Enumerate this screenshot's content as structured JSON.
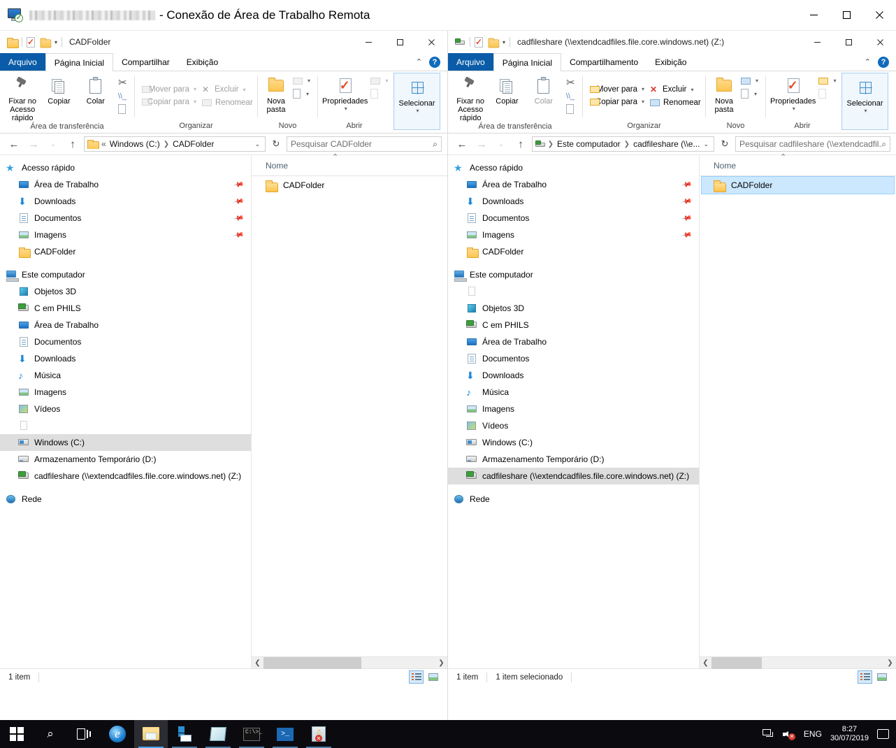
{
  "rdp": {
    "title_suffix": "- Conexão de Área de Trabalho Remota",
    "host_name_redacted": "",
    "controls": {
      "minimize": "—",
      "maximize": "☐",
      "close": "✕"
    }
  },
  "colors": {
    "accent": "#0a5ca8",
    "selection_fill": "#cce8ff",
    "selection_border": "#99d1ff",
    "tree_selection": "#dedede",
    "taskbar": "#0b0b0f"
  },
  "left_window": {
    "qat": {
      "folder_icon": "folder-icon",
      "properties_icon": "properties-icon",
      "new_folder_icon": "new-folder-icon",
      "customize_caret": "▾"
    },
    "title": "CADFolder",
    "controls": {
      "minimize": "—",
      "maximize": "☐",
      "close": "✕"
    },
    "tabs": [
      {
        "label": "Arquivo",
        "type": "file"
      },
      {
        "label": "Página Inicial",
        "type": "active"
      },
      {
        "label": "Compartilhar",
        "type": "normal"
      },
      {
        "label": "Exibição",
        "type": "normal"
      }
    ],
    "ribbon_collapse": "⌃",
    "help_label": "?",
    "ribbon": {
      "clipboard": {
        "group_label": "Área de transferência",
        "pin": "Fixar no\nAcesso rápido",
        "pin_line1": "Fixar no",
        "pin_line2": "Acesso rápido",
        "copy": "Copiar",
        "paste": "Colar",
        "cut_icon": "scissors-icon",
        "copy_path_icon": "copy-path-icon",
        "paste_shortcut_icon": "paste-shortcut-icon"
      },
      "organize": {
        "group_label": "Organizar",
        "move_to": "Mover para",
        "copy_to": "Copiar para",
        "delete": "Excluir",
        "rename": "Renomear"
      },
      "new": {
        "group_label": "Novo",
        "new_folder_line1": "Nova",
        "new_folder_line2": "pasta",
        "new_item_icon": "new-item-icon",
        "easy_access_icon": "easy-access-icon"
      },
      "open": {
        "group_label": "Abrir",
        "properties": "Propriedades",
        "open_icon": "open-icon",
        "edit_icon": "edit-icon",
        "history_icon": "history-icon"
      },
      "select": {
        "group_label": "",
        "select": "Selecionar"
      }
    },
    "nav": {
      "back": "←",
      "forward": "→",
      "recent": "⌄",
      "up": "↑",
      "breadcrumb_prefix": "«",
      "breadcrumb": [
        "Windows (C:)",
        "CADFolder"
      ],
      "breadcrumb_icon": "folder-icon",
      "dropdown": "⌄",
      "refresh": "↻",
      "search_placeholder": "Pesquisar CADFolder"
    },
    "tree": [
      {
        "label": "Acesso rápido",
        "icon": "star-icon",
        "indent": 0,
        "pinned": false
      },
      {
        "label": "Área de Trabalho",
        "icon": "desktop-icon",
        "indent": 1,
        "pinned": true
      },
      {
        "label": "Downloads",
        "icon": "download-icon",
        "indent": 1,
        "pinned": true
      },
      {
        "label": "Documentos",
        "icon": "documents-icon",
        "indent": 1,
        "pinned": true
      },
      {
        "label": "Imagens",
        "icon": "pictures-icon",
        "indent": 1,
        "pinned": true
      },
      {
        "label": "CADFolder",
        "icon": "folder-icon",
        "indent": 1,
        "pinned": false
      },
      {
        "label": "",
        "icon": "spacer",
        "indent": 0,
        "spacer": true
      },
      {
        "label": "Este computador",
        "icon": "this-pc-icon",
        "indent": 0,
        "pinned": false
      },
      {
        "label": "Objetos 3D",
        "icon": "objects3d-icon",
        "indent": 1,
        "pinned": false
      },
      {
        "label": "C em PHILS",
        "icon": "network-drive-icon",
        "indent": 1,
        "pinned": false
      },
      {
        "label": "Área de Trabalho",
        "icon": "desktop-icon",
        "indent": 1,
        "pinned": false
      },
      {
        "label": "Documentos",
        "icon": "documents-icon",
        "indent": 1,
        "pinned": false
      },
      {
        "label": "Downloads",
        "icon": "download-icon",
        "indent": 1,
        "pinned": false
      },
      {
        "label": "Música",
        "icon": "music-icon",
        "indent": 1,
        "pinned": false
      },
      {
        "label": "Imagens",
        "icon": "pictures-icon",
        "indent": 1,
        "pinned": false
      },
      {
        "label": "Vídeos",
        "icon": "videos-icon",
        "indent": 1,
        "pinned": false
      },
      {
        "label": "",
        "icon": "blank-icon",
        "indent": 1,
        "pinned": false
      },
      {
        "label": "Windows (C:)",
        "icon": "windows-drive-icon",
        "indent": 1,
        "selected": true
      },
      {
        "label": "Armazenamento Temporário (D:)",
        "icon": "hdd-icon",
        "indent": 1,
        "pinned": false
      },
      {
        "label": "cadfileshare (\\\\extendcadfiles.file.core.windows.net) (Z:)",
        "icon": "network-drive-icon",
        "indent": 1,
        "pinned": false
      },
      {
        "label": "",
        "icon": "spacer",
        "indent": 0,
        "spacer": true
      },
      {
        "label": "Rede",
        "icon": "network-icon",
        "indent": 0,
        "pinned": false
      }
    ],
    "list": {
      "column_header": "Nome",
      "sort_arrow": "⌃",
      "items": [
        {
          "label": "CADFolder",
          "icon": "folder-icon",
          "selected": false
        }
      ]
    },
    "status": {
      "count": "1 item",
      "selected": ""
    },
    "view_buttons": {
      "details": "details-view-icon",
      "large": "large-icons-view-icon"
    }
  },
  "right_window": {
    "qat": {
      "drive_icon": "network-drive-icon",
      "properties_icon": "properties-icon",
      "new_folder_icon": "new-folder-icon",
      "customize_caret": "▾"
    },
    "title": "cadfileshare (\\\\extendcadfiles.file.core.windows.net) (Z:)",
    "controls": {
      "minimize": "—",
      "maximize": "☐",
      "close": "✕"
    },
    "tabs": [
      {
        "label": "Arquivo",
        "type": "file"
      },
      {
        "label": "Página Inicial",
        "type": "active"
      },
      {
        "label": "Compartilhamento",
        "type": "normal"
      },
      {
        "label": "Exibição",
        "type": "normal"
      }
    ],
    "ribbon_collapse": "⌃",
    "help_label": "?",
    "nav": {
      "back": "←",
      "forward": "→",
      "recent": "⌄",
      "up": "↑",
      "breadcrumb": [
        "Este computador",
        "cadfileshare (\\\\e..."
      ],
      "breadcrumb_icon": "network-drive-icon",
      "dropdown": "⌄",
      "refresh": "↻",
      "search_placeholder": "Pesquisar cadfileshare (\\\\extendcadfil..."
    },
    "tree": [
      {
        "label": "Acesso rápido",
        "icon": "star-icon",
        "indent": 0,
        "pinned": false
      },
      {
        "label": "Área de Trabalho",
        "icon": "desktop-icon",
        "indent": 1,
        "pinned": true
      },
      {
        "label": "Downloads",
        "icon": "download-icon",
        "indent": 1,
        "pinned": true
      },
      {
        "label": "Documentos",
        "icon": "documents-icon",
        "indent": 1,
        "pinned": true
      },
      {
        "label": "Imagens",
        "icon": "pictures-icon",
        "indent": 1,
        "pinned": true
      },
      {
        "label": "CADFolder",
        "icon": "folder-icon",
        "indent": 1,
        "pinned": false
      },
      {
        "label": "",
        "icon": "spacer",
        "indent": 0,
        "spacer": true
      },
      {
        "label": "Este computador",
        "icon": "this-pc-icon",
        "indent": 0,
        "pinned": false
      },
      {
        "label": "",
        "icon": "blank-icon",
        "indent": 1,
        "pinned": false
      },
      {
        "label": "Objetos 3D",
        "icon": "objects3d-icon",
        "indent": 1,
        "pinned": false
      },
      {
        "label": "C em PHILS",
        "icon": "network-drive-icon",
        "indent": 1,
        "pinned": false
      },
      {
        "label": "Área de Trabalho",
        "icon": "desktop-icon",
        "indent": 1,
        "pinned": false
      },
      {
        "label": "Documentos",
        "icon": "documents-icon",
        "indent": 1,
        "pinned": false
      },
      {
        "label": "Downloads",
        "icon": "download-icon",
        "indent": 1,
        "pinned": false
      },
      {
        "label": "Música",
        "icon": "music-icon",
        "indent": 1,
        "pinned": false
      },
      {
        "label": "Imagens",
        "icon": "pictures-icon",
        "indent": 1,
        "pinned": false
      },
      {
        "label": "Vídeos",
        "icon": "videos-icon",
        "indent": 1,
        "pinned": false
      },
      {
        "label": "Windows (C:)",
        "icon": "windows-drive-icon",
        "indent": 1,
        "pinned": false
      },
      {
        "label": "Armazenamento Temporário (D:)",
        "icon": "hdd-icon",
        "indent": 1,
        "pinned": false
      },
      {
        "label": "cadfileshare (\\\\extendcadfiles.file.core.windows.net) (Z:)",
        "icon": "network-drive-icon",
        "indent": 1,
        "selected": true
      },
      {
        "label": "",
        "icon": "spacer",
        "indent": 0,
        "spacer": true
      },
      {
        "label": "Rede",
        "icon": "network-icon",
        "indent": 0,
        "pinned": false
      }
    ],
    "list": {
      "column_header": "Nome",
      "sort_arrow": "⌃",
      "items": [
        {
          "label": "CADFolder",
          "icon": "folder-icon",
          "selected": true
        }
      ]
    },
    "status": {
      "count": "1 item",
      "selected": "1 item selecionado"
    },
    "view_buttons": {
      "details": "details-view-icon",
      "large": "large-icons-view-icon"
    }
  },
  "taskbar": {
    "items": [
      {
        "name": "start-button",
        "label": ""
      },
      {
        "name": "search-button",
        "label": ""
      },
      {
        "name": "task-view-button",
        "label": ""
      },
      {
        "name": "internet-explorer-button",
        "label": "e"
      },
      {
        "name": "file-explorer-button",
        "label": ""
      },
      {
        "name": "server-manager-button",
        "label": ""
      },
      {
        "name": "sticky-notes-button",
        "label": ""
      },
      {
        "name": "command-prompt-button",
        "label": "C:\\>_"
      },
      {
        "name": "powershell-button",
        "label": ">_"
      },
      {
        "name": "event-viewer-button",
        "label": ""
      }
    ],
    "tray": {
      "network_icon": "network-tray-icon",
      "volume_icon": "volume-muted-icon",
      "language": "ENG",
      "time": "8:27",
      "date": "30/07/2019",
      "notifications_icon": "notifications-icon"
    }
  }
}
